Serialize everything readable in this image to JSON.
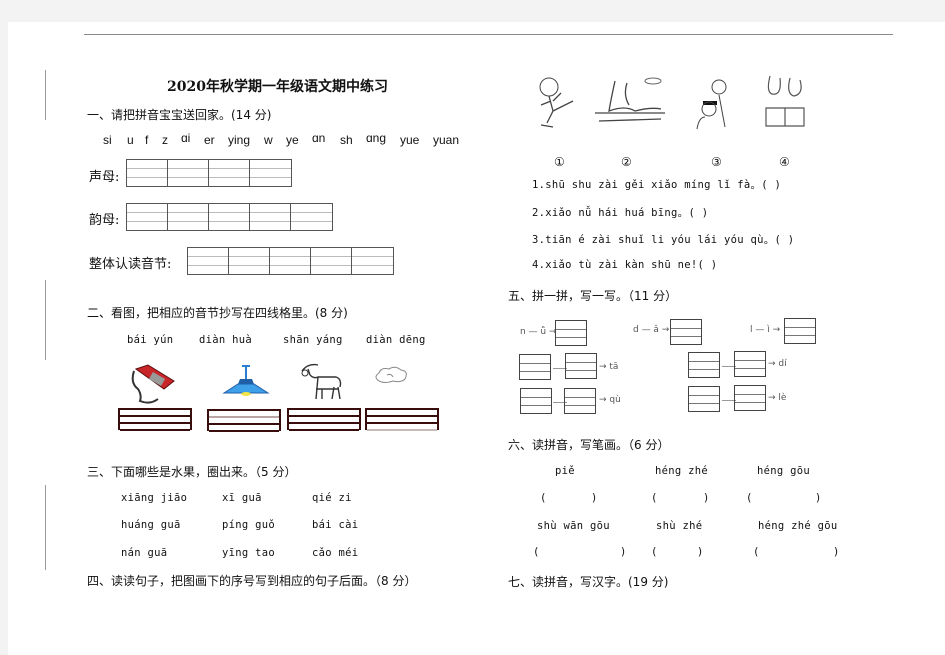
{
  "title": "2020年秋学期一年级语文期中练习",
  "sec1": {
    "heading": "一、请把拼音宝宝送回家。(14 分)",
    "letters": [
      "si",
      "u",
      "f",
      "z",
      "ɑi",
      "er",
      "ying",
      "w",
      "ye",
      "ɑn",
      "sh",
      "ɑng",
      "yue",
      "yuan"
    ],
    "rows": [
      {
        "label": "声母:",
        "cells": 4
      },
      {
        "label": "韵母:",
        "cells": 5
      },
      {
        "label": "整体认读音节:",
        "cells": 5
      }
    ]
  },
  "sec2": {
    "heading": "二、看图，把相应的音节抄写在四线格里。(8 分)",
    "items": [
      {
        "pinyin": "bái  yún",
        "icon": "telephone-icon"
      },
      {
        "pinyin": "diàn  huà",
        "icon": "ceiling-lamp-icon"
      },
      {
        "pinyin": "shān  yáng",
        "icon": "goat-icon"
      },
      {
        "pinyin": "diàn dēng",
        "icon": "cloud-icon"
      }
    ]
  },
  "sec3": {
    "heading": "三、下面哪些是水果，圈出来。（5 分）",
    "rows": [
      [
        "xiāng jiāo",
        "xī guā",
        "qié  zi"
      ],
      [
        "huáng guā",
        "píng guǒ",
        "bái cài"
      ],
      [
        "nán guā",
        "yīng tao",
        "cǎo méi"
      ]
    ]
  },
  "sec4": {
    "heading": "四、读读句子，把图画下的序号写到相应的句子后面。（8 分）",
    "pictures": [
      {
        "num": "①",
        "icon": "skating-boy-icon"
      },
      {
        "num": "②",
        "icon": "swans-icon"
      },
      {
        "num": "③",
        "icon": "barber-icon"
      },
      {
        "num": "④",
        "icon": "rabbits-reading-icon"
      }
    ],
    "sentences": [
      "1.shū  shu  zài  gěi  xiǎo  míng  lǐ  fà。(   )",
      "2.xiǎo  nǚ  hái  huá  bīng。(   )",
      "3.tiān  é  zài  shuǐ  li  yóu  lái  yóu  qù。(   )",
      "4.xiǎo  tù  zài  kàn  shū  ne!(   )"
    ]
  },
  "sec5": {
    "heading": "五、拼一拼，写一写。（11 分）",
    "top": [
      "n — ǚ →",
      "d — ǎ →",
      "l — ì →"
    ],
    "left_results": [
      "→ tā",
      "→ qù"
    ],
    "right_results": [
      "→ dí",
      "→ lè"
    ]
  },
  "sec6": {
    "heading": "六、读拼音，写笔画。（6 分）",
    "row1": [
      "piě",
      "héng zhé",
      "héng gōu"
    ],
    "row2": [
      "shù wān gōu",
      "shù zhé",
      "héng zhé gōu"
    ],
    "paren_open": "(",
    "paren_close": ")"
  },
  "sec7": {
    "heading": "七、读拼音，写汉字。(19 分)"
  }
}
